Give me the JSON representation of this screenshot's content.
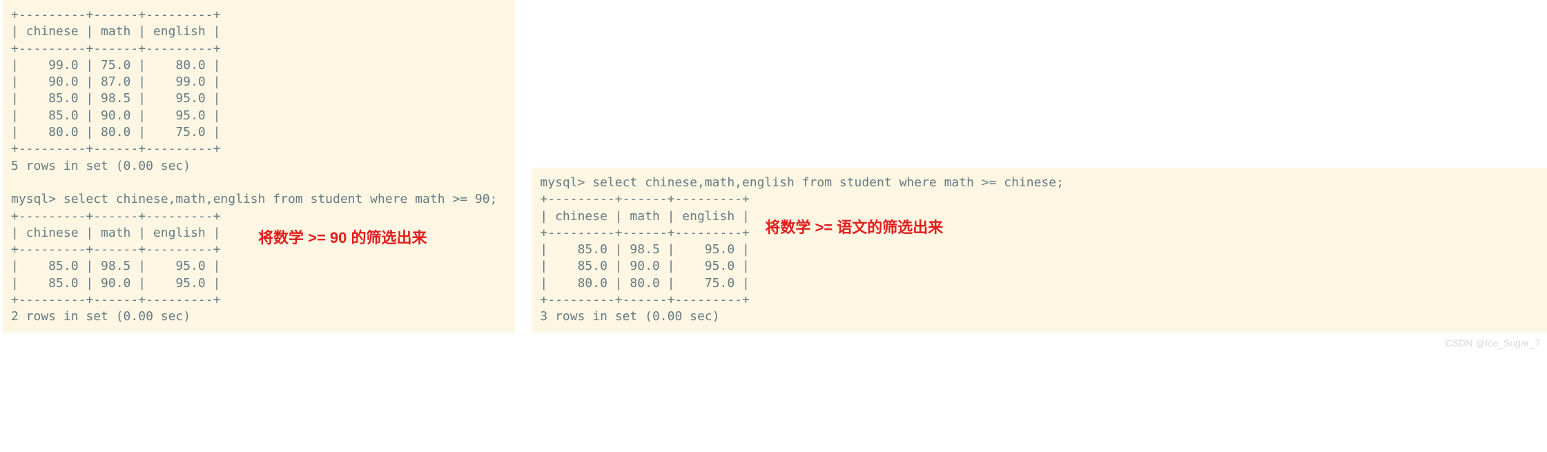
{
  "left": {
    "table1": {
      "border": "+---------+------+---------+",
      "header": "| chinese | math | english |",
      "rows": [
        "|    99.0 | 75.0 |    80.0 |",
        "|    90.0 | 87.0 |    99.0 |",
        "|    85.0 | 98.5 |    95.0 |",
        "|    85.0 | 90.0 |    95.0 |",
        "|    80.0 | 80.0 |    75.0 |"
      ],
      "footer": "5 rows in set (0.00 sec)"
    },
    "query2": "mysql> select chinese,math,english from student where math >= 90;",
    "table2": {
      "border": "+---------+------+---------+",
      "header": "| chinese | math | english |",
      "rows": [
        "|    85.0 | 98.5 |    95.0 |",
        "|    85.0 | 90.0 |    95.0 |"
      ],
      "footer": "2 rows in set (0.00 sec)"
    },
    "annotation": "将数学 >= 90 的筛选出来"
  },
  "right": {
    "query": "mysql> select chinese,math,english from student where math >= chinese;",
    "table": {
      "border": "+---------+------+---------+",
      "header": "| chinese | math | english |",
      "rows": [
        "|    85.0 | 98.5 |    95.0 |",
        "|    85.0 | 90.0 |    95.0 |",
        "|    80.0 | 80.0 |    75.0 |"
      ],
      "footer": "3 rows in set (0.00 sec)"
    },
    "annotation": "将数学 >= 语文的筛选出来"
  },
  "watermark": "CSDN @Ice_Sugar_7",
  "chart_data": [
    {
      "type": "table",
      "title": "student (all rows shown)",
      "columns": [
        "chinese",
        "math",
        "english"
      ],
      "rows": [
        [
          99.0,
          75.0,
          80.0
        ],
        [
          90.0,
          87.0,
          99.0
        ],
        [
          85.0,
          98.5,
          95.0
        ],
        [
          85.0,
          90.0,
          95.0
        ],
        [
          80.0,
          80.0,
          75.0
        ]
      ],
      "footer": "5 rows in set (0.00 sec)"
    },
    {
      "type": "table",
      "title": "select chinese,math,english from student where math >= 90",
      "columns": [
        "chinese",
        "math",
        "english"
      ],
      "rows": [
        [
          85.0,
          98.5,
          95.0
        ],
        [
          85.0,
          90.0,
          95.0
        ]
      ],
      "footer": "2 rows in set (0.00 sec)"
    },
    {
      "type": "table",
      "title": "select chinese,math,english from student where math >= chinese",
      "columns": [
        "chinese",
        "math",
        "english"
      ],
      "rows": [
        [
          85.0,
          98.5,
          95.0
        ],
        [
          85.0,
          90.0,
          95.0
        ],
        [
          80.0,
          80.0,
          75.0
        ]
      ],
      "footer": "3 rows in set (0.00 sec)"
    }
  ]
}
